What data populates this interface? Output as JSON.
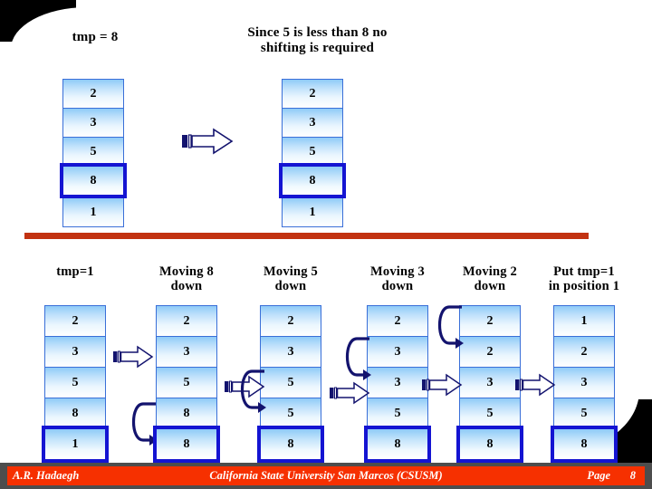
{
  "slide": {
    "top_section": {
      "left_caption": "tmp = 8",
      "right_caption_line1": "Since 5 is less than 8 no",
      "right_caption_line2": "shifting is required",
      "left_stack": {
        "name": "array-before",
        "values": [
          "2",
          "3",
          "5",
          "8",
          "1"
        ],
        "highlight_index": 3
      },
      "right_stack": {
        "name": "array-after",
        "values": [
          "2",
          "3",
          "5",
          "8",
          "1"
        ],
        "highlight_index": 3
      },
      "arrow_label": "right-arrow"
    },
    "bottom_section": {
      "columns": [
        {
          "caption_line1": "tmp=1",
          "caption_line2": "",
          "values": [
            "2",
            "3",
            "5",
            "8",
            "1"
          ],
          "highlight_index": 4
        },
        {
          "caption_line1": "Moving 8",
          "caption_line2": "down",
          "values": [
            "2",
            "3",
            "5",
            "8",
            "8"
          ],
          "highlight_index": 4
        },
        {
          "caption_line1": "Moving 5",
          "caption_line2": "down",
          "values": [
            "2",
            "3",
            "5",
            "5",
            "8"
          ],
          "highlight_index": 4
        },
        {
          "caption_line1": "Moving 3",
          "caption_line2": "down",
          "values": [
            "2",
            "3",
            "3",
            "5",
            "8"
          ],
          "highlight_index": 4
        },
        {
          "caption_line1": "Moving 2",
          "caption_line2": "down",
          "values": [
            "2",
            "2",
            "3",
            "5",
            "8"
          ],
          "highlight_index": 4
        },
        {
          "caption_line1": "Put tmp=1",
          "caption_line2": "in position 1",
          "values": [
            "1",
            "2",
            "3",
            "5",
            "8"
          ],
          "highlight_index": 4
        }
      ]
    },
    "colors": {
      "divider": "#c23211",
      "footer_bar": "#f63000",
      "footer_frame": "#4d4d4d",
      "cell_border": "#3a6fd8",
      "highlight_border": "#1414d2",
      "arrow_outline": "#13136e"
    }
  },
  "footer": {
    "author": "A.R. Hadaegh",
    "institution": "California State University San Marcos (CSUSM)",
    "page_label": "Page",
    "page_number": "8"
  }
}
